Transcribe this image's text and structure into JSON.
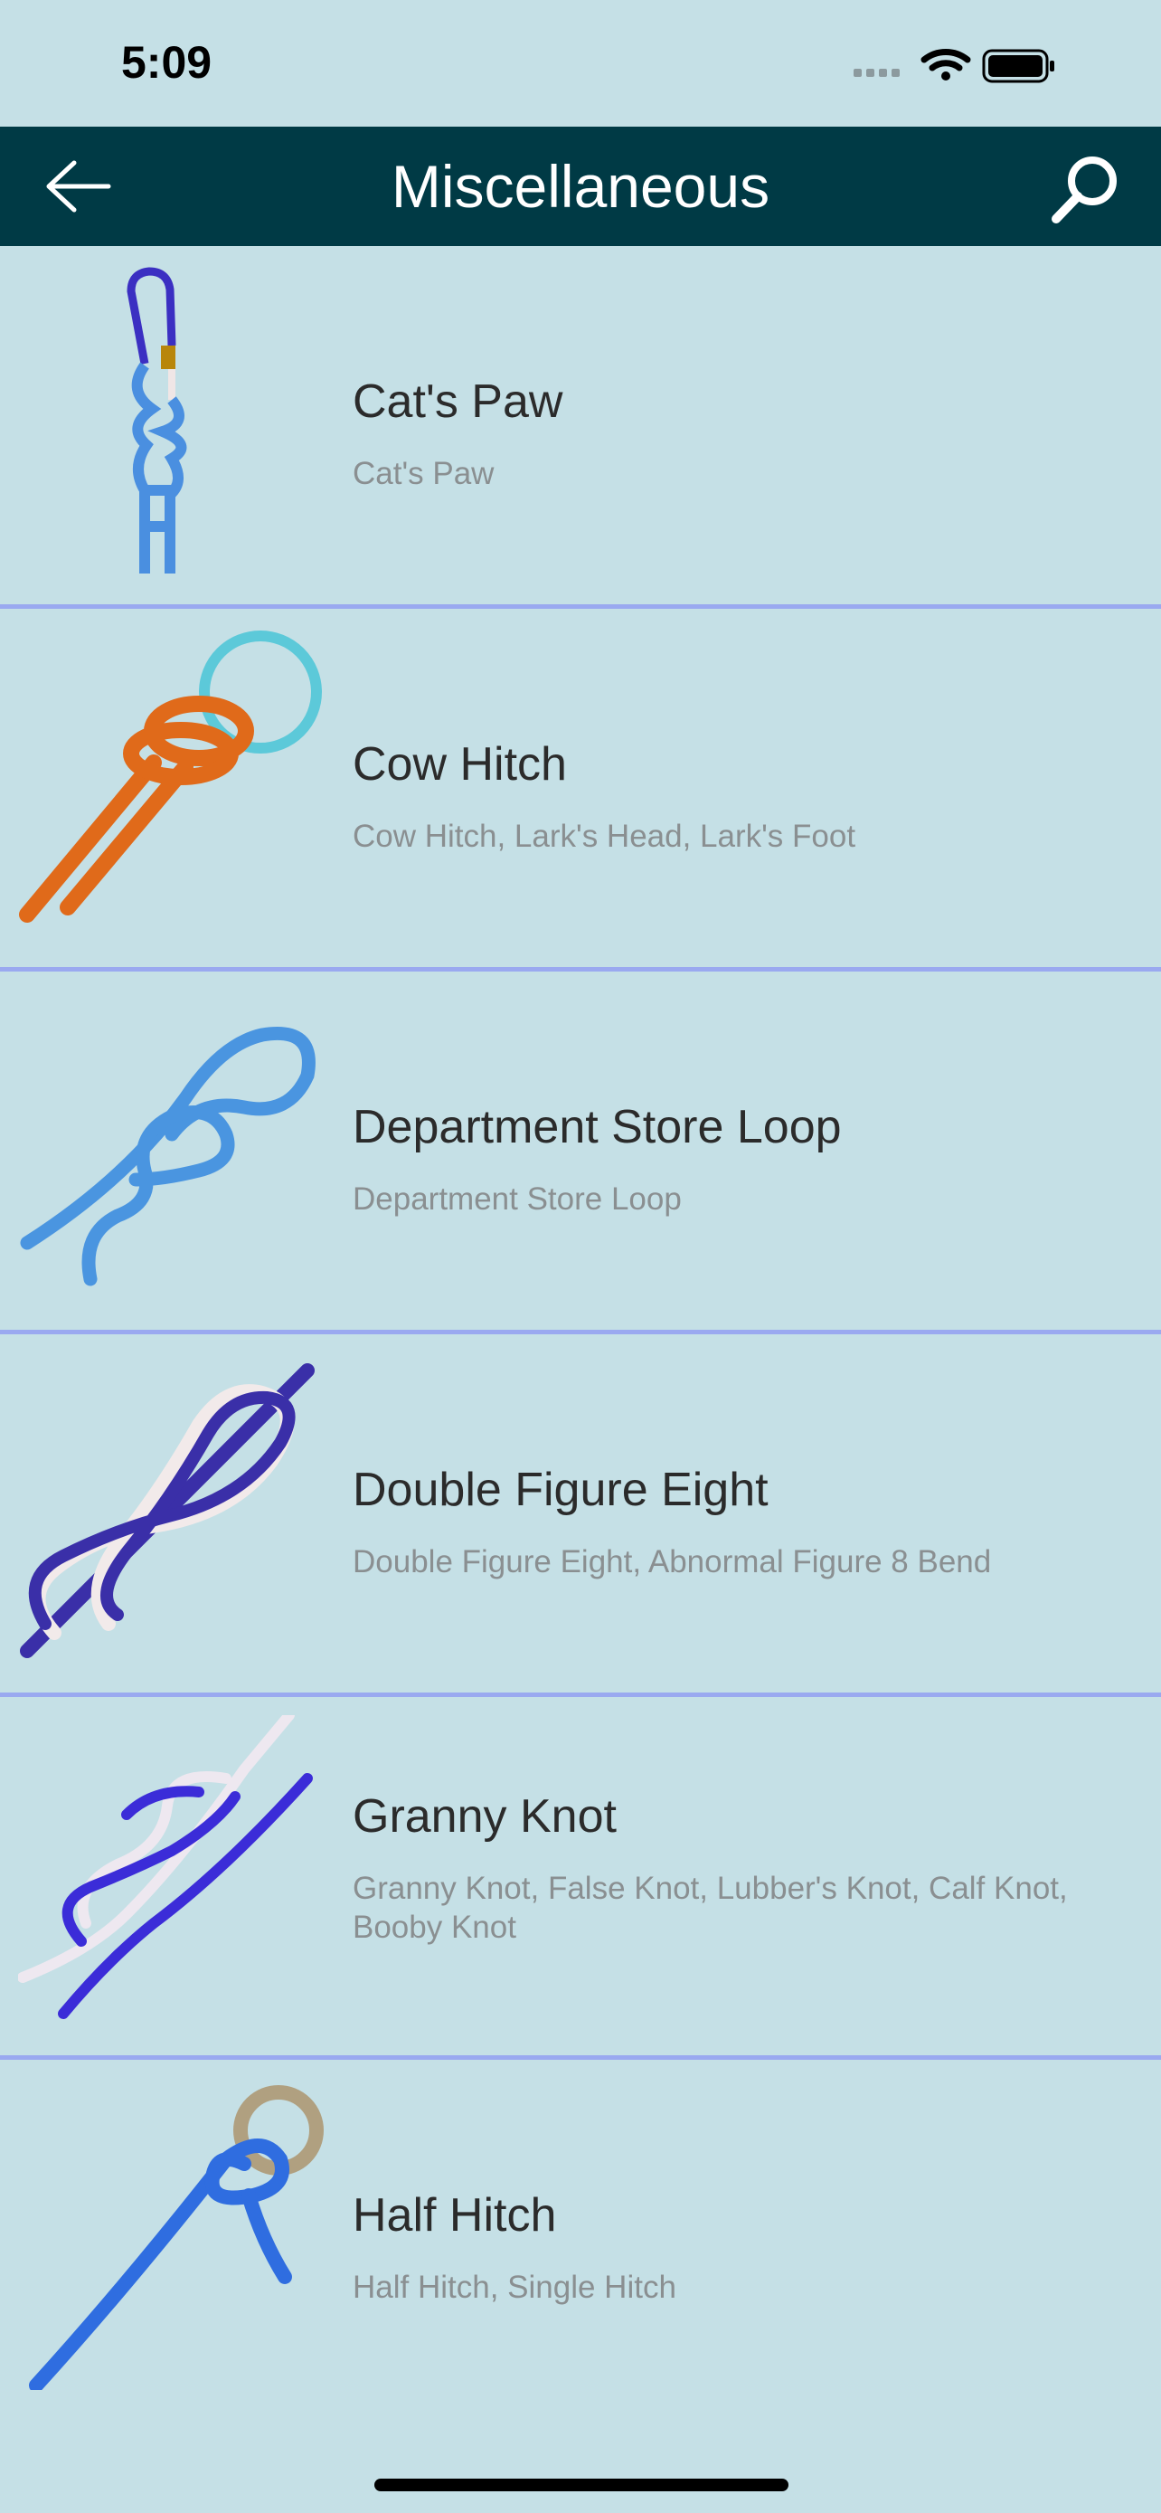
{
  "status_bar": {
    "time": "5:09"
  },
  "nav": {
    "title": "Miscellaneous"
  },
  "knots": [
    {
      "title": "Cat's Paw",
      "aliases": "Cat's Paw",
      "icon": "carabiner-knot-icon"
    },
    {
      "title": "Cow Hitch",
      "aliases": "Cow Hitch, Lark's Head, Lark's Foot",
      "icon": "ring-knot-icon"
    },
    {
      "title": "Department Store Loop",
      "aliases": "Department Store Loop",
      "icon": "loop-knot-icon"
    },
    {
      "title": "Double Figure Eight",
      "aliases": "Double Figure Eight, Abnormal Figure 8 Bend",
      "icon": "figure-eight-knot-icon"
    },
    {
      "title": "Granny Knot",
      "aliases": "Granny Knot, False Knot, Lubber's Knot, Calf Knot, Booby Knot",
      "icon": "granny-knot-icon"
    },
    {
      "title": "Half Hitch",
      "aliases": "Half Hitch, Single Hitch",
      "icon": "half-hitch-knot-icon"
    }
  ],
  "colors": {
    "background": "#c5e0e6",
    "nav_bar": "#003a45",
    "divider": "#9aa9f0",
    "title_text": "#2b2b2b",
    "subtitle_text": "#8a8f91"
  }
}
